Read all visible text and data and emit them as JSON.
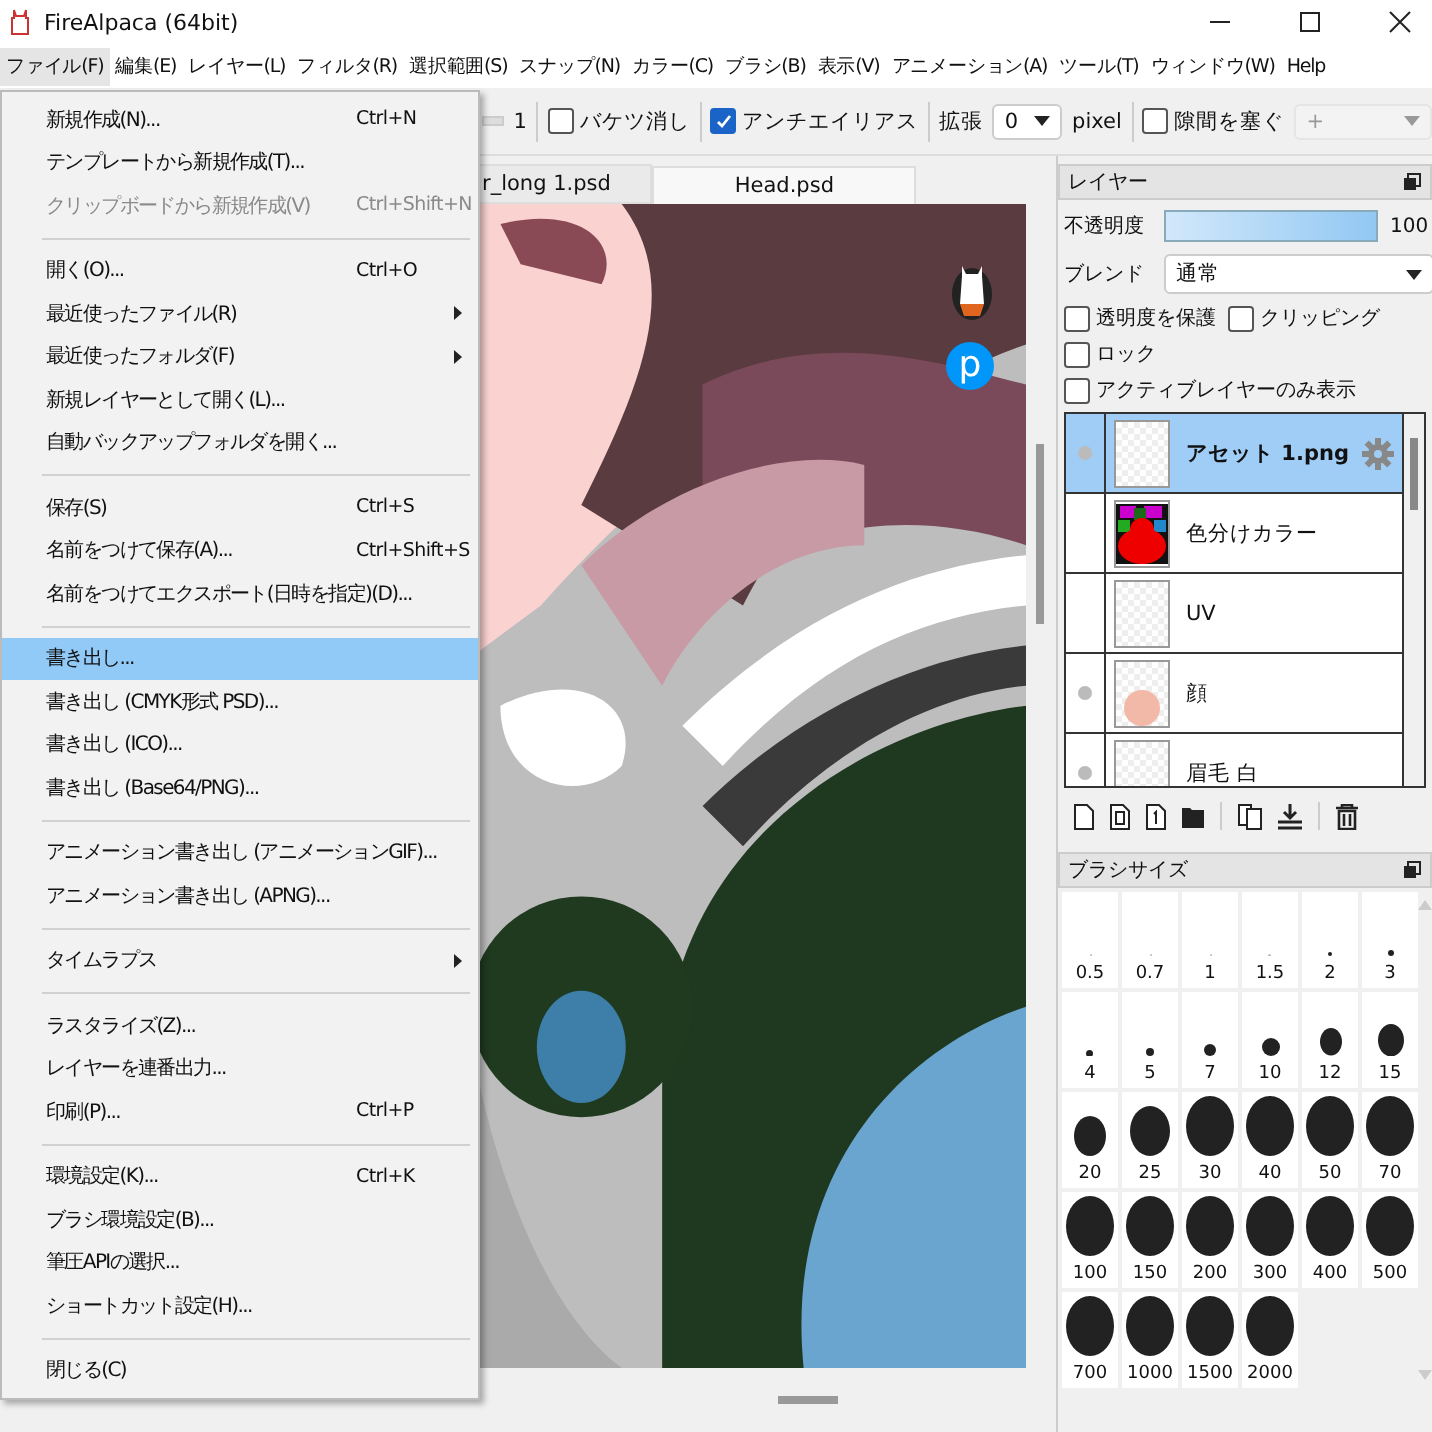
{
  "window": {
    "title": "FireAlpaca (64bit)"
  },
  "menubar": [
    {
      "label": "ファイル(F)",
      "selected": true
    },
    {
      "label": "編集(E)",
      "selected": false
    },
    {
      "label": "レイヤー(L)",
      "selected": false
    },
    {
      "label": "フィルタ(R)",
      "selected": false
    },
    {
      "label": "選択範囲(S)",
      "selected": false
    },
    {
      "label": "スナップ(N)",
      "selected": false
    },
    {
      "label": "カラー(C)",
      "selected": false
    },
    {
      "label": "ブラシ(B)",
      "selected": false
    },
    {
      "label": "表示(V)",
      "selected": false
    },
    {
      "label": "アニメーション(A)",
      "selected": false
    },
    {
      "label": "ツール(T)",
      "selected": false
    },
    {
      "label": "ウィンドウ(W)",
      "selected": false
    },
    {
      "label": "Help",
      "selected": false
    }
  ],
  "toolbar": {
    "slider_value": "1",
    "options": [
      {
        "label": "バケツ消し",
        "checked": false
      },
      {
        "label": "アンチエイリアス",
        "checked": true
      }
    ],
    "expand_label": "拡張",
    "expand_value": "0",
    "unit": "pixel",
    "gap_option": {
      "label": "隙間を塞ぐ",
      "checked": false
    },
    "gap_value": "+"
  },
  "file_menu": [
    {
      "kind": "item",
      "label": "新規作成(N)...",
      "shortcut": "Ctrl+N",
      "submenu": false,
      "disabled": false,
      "selected": false
    },
    {
      "kind": "item",
      "label": "テンプレートから新規作成(T)...",
      "submenu": false,
      "disabled": false,
      "selected": false
    },
    {
      "kind": "item",
      "label": "クリップボードから新規作成(V)",
      "shortcut": "Ctrl+Shift+N",
      "submenu": false,
      "disabled": true,
      "selected": false
    },
    {
      "kind": "separator"
    },
    {
      "kind": "item",
      "label": "開く(O)...",
      "shortcut": "Ctrl+O",
      "submenu": false,
      "disabled": false,
      "selected": false
    },
    {
      "kind": "item",
      "label": "最近使ったファイル(R)",
      "submenu": true,
      "disabled": false,
      "selected": false
    },
    {
      "kind": "item",
      "label": "最近使ったフォルダ(F)",
      "submenu": true,
      "disabled": false,
      "selected": false
    },
    {
      "kind": "item",
      "label": "新規レイヤーとして開く(L)...",
      "submenu": false,
      "disabled": false,
      "selected": false
    },
    {
      "kind": "item",
      "label": "自動バックアップフォルダを開く...",
      "submenu": false,
      "disabled": false,
      "selected": false
    },
    {
      "kind": "separator"
    },
    {
      "kind": "item",
      "label": "保存(S)",
      "shortcut": "Ctrl+S",
      "submenu": false,
      "disabled": false,
      "selected": false
    },
    {
      "kind": "item",
      "label": "名前をつけて保存(A)...",
      "shortcut": "Ctrl+Shift+S",
      "submenu": false,
      "disabled": false,
      "selected": false
    },
    {
      "kind": "item",
      "label": "名前をつけてエクスポート(日時を指定)(D)...",
      "submenu": false,
      "disabled": false,
      "selected": false
    },
    {
      "kind": "separator"
    },
    {
      "kind": "item",
      "label": "書き出し...",
      "submenu": false,
      "disabled": false,
      "selected": true
    },
    {
      "kind": "item",
      "label": "書き出し (CMYK形式 PSD)...",
      "submenu": false,
      "disabled": false,
      "selected": false
    },
    {
      "kind": "item",
      "label": "書き出し (ICO)...",
      "submenu": false,
      "disabled": false,
      "selected": false
    },
    {
      "kind": "item",
      "label": "書き出し (Base64/PNG)...",
      "submenu": false,
      "disabled": false,
      "selected": false
    },
    {
      "kind": "separator"
    },
    {
      "kind": "item",
      "label": "アニメーション書き出し (アニメーションGIF)...",
      "submenu": false,
      "disabled": false,
      "selected": false
    },
    {
      "kind": "item",
      "label": "アニメーション書き出し (APNG)...",
      "submenu": false,
      "disabled": false,
      "selected": false
    },
    {
      "kind": "separator"
    },
    {
      "kind": "item",
      "label": "タイムラプス",
      "submenu": true,
      "disabled": false,
      "selected": false
    },
    {
      "kind": "separator"
    },
    {
      "kind": "item",
      "label": "ラスタライズ(Z)...",
      "submenu": false,
      "disabled": false,
      "selected": false
    },
    {
      "kind": "item",
      "label": "レイヤーを連番出力...",
      "submenu": false,
      "disabled": false,
      "selected": false
    },
    {
      "kind": "item",
      "label": "印刷(P)...",
      "shortcut": "Ctrl+P",
      "submenu": false,
      "disabled": false,
      "selected": false
    },
    {
      "kind": "separator"
    },
    {
      "kind": "item",
      "label": "環境設定(K)...",
      "shortcut": "Ctrl+K",
      "submenu": false,
      "disabled": false,
      "selected": false
    },
    {
      "kind": "item",
      "label": "ブラシ環境設定(B)...",
      "submenu": false,
      "disabled": false,
      "selected": false
    },
    {
      "kind": "item",
      "label": "筆圧APIの選択...",
      "submenu": false,
      "disabled": false,
      "selected": false
    },
    {
      "kind": "item",
      "label": "ショートカット設定(H)...",
      "submenu": false,
      "disabled": false,
      "selected": false
    },
    {
      "kind": "separator"
    },
    {
      "kind": "item",
      "label": "閉じる(C)",
      "submenu": false,
      "disabled": false,
      "selected": false
    }
  ],
  "document_tabs": [
    {
      "label": "r_long 1.psd",
      "selected": false
    },
    {
      "label": "Head.psd",
      "selected": true
    }
  ],
  "canvas_badges": [
    {
      "kind": "alpaca"
    },
    {
      "kind": "letter",
      "label": "p"
    }
  ],
  "layer_panel": {
    "title": "レイヤー",
    "opacity_label": "不透明度",
    "opacity": {
      "level": 1.0
    },
    "opacity_reading": "100",
    "blend_label": "ブレンド",
    "blend_value": "通常",
    "options": [
      {
        "label": "透明度を保護",
        "checked": false
      },
      {
        "label": "クリッピング",
        "checked": false
      },
      {
        "label": "ロック",
        "checked": false
      },
      {
        "label": "アクティブレイヤーのみ表示",
        "checked": false
      }
    ],
    "layers": [
      {
        "name": "アセット 1.png",
        "kind": "checker",
        "visible": true,
        "selected": true
      },
      {
        "name": "色分けカラー",
        "kind": "color-map",
        "visible": false,
        "selected": false
      },
      {
        "name": "UV",
        "kind": "checker",
        "visible": false,
        "selected": false
      },
      {
        "name": "顔",
        "kind": "skin",
        "visible": true,
        "selected": false
      },
      {
        "name": "眉毛 白",
        "kind": "checker",
        "visible": true,
        "selected": false
      }
    ]
  },
  "brush_panel": {
    "title": "ブラシサイズ",
    "sizes": [
      "0.5",
      "0.7",
      "1",
      "1.5",
      "2",
      "3",
      "4",
      "5",
      "7",
      "10",
      "12",
      "15",
      "20",
      "25",
      "30",
      "40",
      "50",
      "70",
      "100",
      "150",
      "200",
      "300",
      "400",
      "500",
      "700",
      "1000",
      "1500",
      "2000"
    ]
  }
}
